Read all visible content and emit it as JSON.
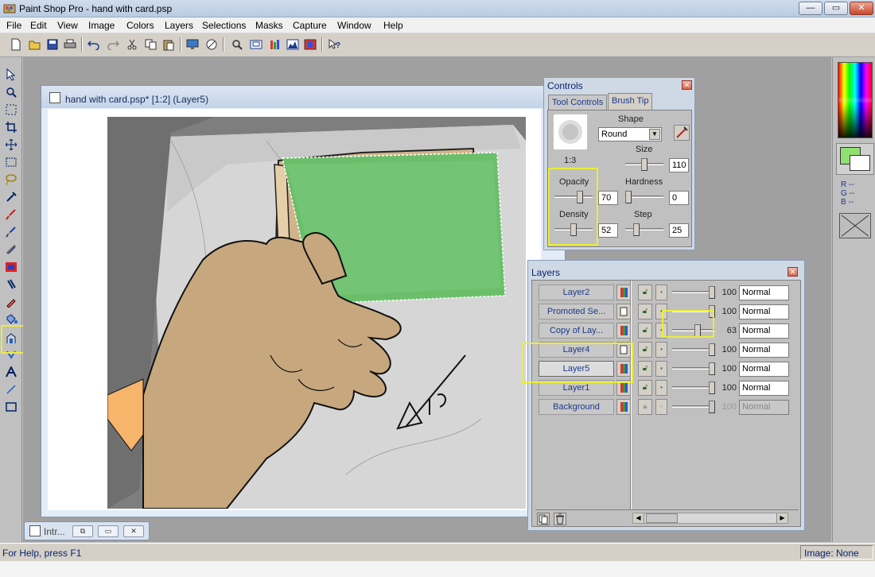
{
  "app": {
    "title": "Paint Shop Pro - hand with card.psp",
    "min_glyph": "—",
    "max_glyph": "▭",
    "close_glyph": "✕"
  },
  "menu": [
    "File",
    "Edit",
    "View",
    "Image",
    "Colors",
    "Layers",
    "Selections",
    "Masks",
    "Capture",
    "Window",
    "Help"
  ],
  "toolbar_icons": [
    "new-icon",
    "open-icon",
    "save-icon",
    "print-icon",
    "undo-icon",
    "redo-icon",
    "cut-icon",
    "copy-icon",
    "paste-icon",
    "full-screen-icon",
    "stop-icon",
    "zoom-icon",
    "overview-icon",
    "histogram-icon",
    "color-palette-icon",
    "split-icon",
    "help-icon"
  ],
  "tools": [
    "arrow-tool-icon",
    "zoom-tool-icon",
    "selection-tool-icon",
    "crop-tool-icon",
    "move-tool-icon",
    "freehand-tool-icon",
    "lasso-tool-icon",
    "dropper-tool-icon",
    "paintbrush-tool-icon",
    "clone-brush-icon",
    "retouch-tool-icon",
    "color-replacer-icon",
    "scratch-remover-icon",
    "eraser-tool-icon",
    "flood-fill-icon",
    "picture-tube-icon",
    "airbrush-icon",
    "text-tool-icon",
    "line-tool-icon",
    "shape-tool-icon"
  ],
  "image_window": {
    "title": "hand with card.psp* [1:2] (Layer5)"
  },
  "minimized_window": {
    "title": "Intr..."
  },
  "color_palette": {
    "foreground": "#8fe070",
    "background": "#ffffff",
    "rgb_lines": [
      "R --",
      "G --",
      "B --"
    ]
  },
  "controls": {
    "title": "Controls",
    "tabs": [
      "Tool Controls",
      "Brush Tip"
    ],
    "active_tab": "Brush Tip",
    "ratio": "1:3",
    "shape_label": "Shape",
    "shape_value": "Round",
    "size_label": "Size",
    "size_value": "110",
    "opacity_label": "Opacity",
    "opacity_value": "70",
    "hardness_label": "Hardness",
    "hardness_value": "0",
    "density_label": "Density",
    "density_value": "52",
    "step_label": "Step",
    "step_value": "25"
  },
  "layers": {
    "title": "Layers",
    "items": [
      {
        "name": "Layer2",
        "opacity": "100",
        "blend": "Normal"
      },
      {
        "name": "Promoted Se...",
        "opacity": "100",
        "blend": "Normal"
      },
      {
        "name": "Copy of Lay...",
        "opacity": "63",
        "blend": "Normal"
      },
      {
        "name": "Layer4",
        "opacity": "100",
        "blend": "Normal"
      },
      {
        "name": "Layer5",
        "opacity": "100",
        "blend": "Normal"
      },
      {
        "name": "Layer1",
        "opacity": "100",
        "blend": "Normal"
      },
      {
        "name": "Background",
        "opacity": "100",
        "blend": "Normal"
      }
    ],
    "active_layer": "Layer5"
  },
  "status": {
    "left": "For Help, press F1",
    "right": "Image: None"
  }
}
